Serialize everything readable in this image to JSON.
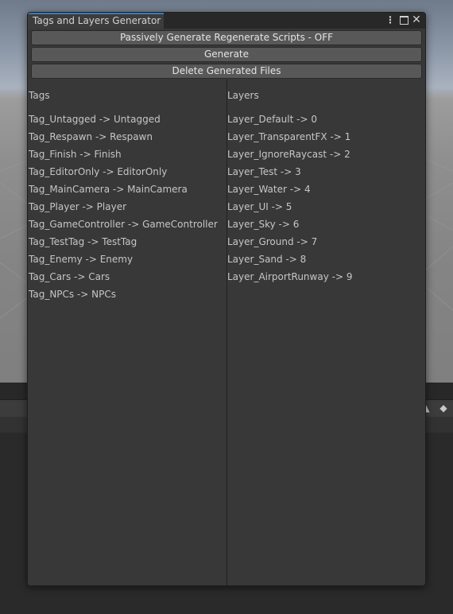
{
  "window": {
    "title": "Tags and Layers Generator",
    "menu_icon": "kebab-menu-icon",
    "maximize_icon": "maximize-icon",
    "close_icon": "close-icon"
  },
  "buttons": {
    "passive_generate": "Passively Generate Regenerate Scripts - OFF",
    "generate": "Generate",
    "delete_files": "Delete Generated Files"
  },
  "tags": {
    "header": "Tags",
    "items": [
      "Tag_Untagged -> Untagged",
      "Tag_Respawn -> Respawn",
      "Tag_Finish -> Finish",
      "Tag_EditorOnly -> EditorOnly",
      "Tag_MainCamera -> MainCamera",
      "Tag_Player -> Player",
      "Tag_GameController -> GameController",
      "Tag_TestTag -> TestTag",
      "Tag_Enemy -> Enemy",
      "Tag_Cars -> Cars",
      "Tag_NPCs -> NPCs"
    ]
  },
  "layers": {
    "header": "Layers",
    "items": [
      "Layer_Default -> 0",
      "Layer_TransparentFX -> 1",
      "Layer_IgnoreRaycast -> 2",
      "Layer_Test -> 3",
      "Layer_Water -> 4",
      "Layer_UI -> 5",
      "Layer_Sky -> 6",
      "Layer_Ground -> 7",
      "Layer_Sand -> 8",
      "Layer_AirportRunway -> 9"
    ]
  },
  "background_toolbar": {
    "icons": [
      "pin-icon",
      "tag-icon"
    ]
  },
  "colors": {
    "accent": "#3a79bb",
    "window_bg": "#383838",
    "button_bg": "#585858",
    "text": "#c6c6c6"
  }
}
